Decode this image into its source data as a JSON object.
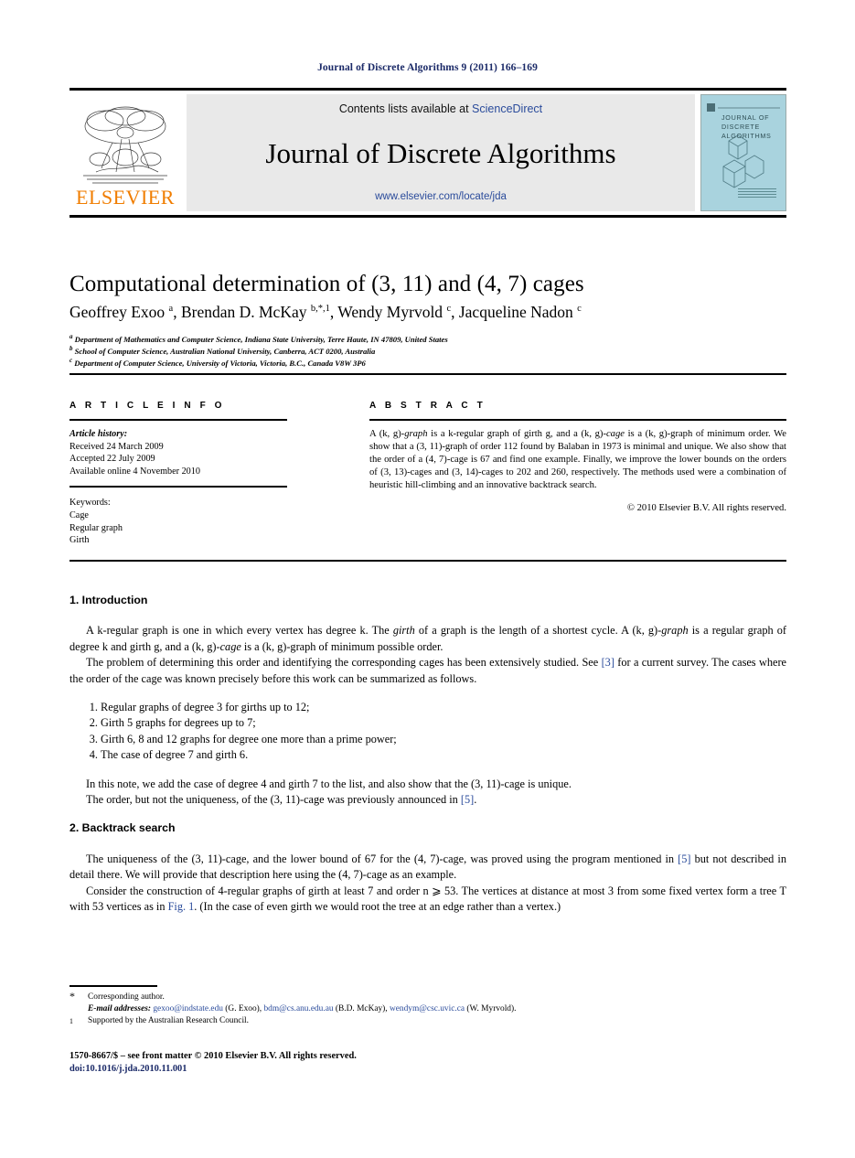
{
  "running_head": "Journal of Discrete Algorithms 9 (2011) 166–169",
  "masthead": {
    "publisher_name": "ELSEVIER",
    "contents_prefix": "Contents lists available at ",
    "contents_link": "ScienceDirect",
    "journal_name": "Journal of Discrete Algorithms",
    "journal_url": "www.elsevier.com/locate/jda",
    "cover_title_line1": "JOURNAL OF",
    "cover_title_line2": "DISCRETE",
    "cover_title_line3": "ALGORITHMS",
    "link_color": "#2a4b9b",
    "elsevier_orange": "#f07d00",
    "cover_color": "#a9d3de"
  },
  "article": {
    "title": "Computational determination of (3, 11) and (4, 7) cages",
    "authors_html": "Geoffrey Exoo <sup>a</sup>, Brendan D. McKay <sup>b,*,1</sup>, Wendy Myrvold <sup>c</sup>, Jacqueline Nadon <sup>c</sup>",
    "affiliation_a": "Department of Mathematics and Computer Science, Indiana State University, Terre Haute, IN 47809, United States",
    "affiliation_b": "School of Computer Science, Australian National University, Canberra, ACT 0200, Australia",
    "affiliation_c": "Department of Computer Science, University of Victoria, Victoria, B.C., Canada V8W 3P6",
    "mark_a": "a",
    "mark_b": "b",
    "mark_c": "c"
  },
  "info": {
    "heading": "A R T I C L E    I N F O",
    "history_label": "Article history:",
    "received": "Received 24 March 2009",
    "accepted": "Accepted 22 July 2009",
    "available": "Available online 4 November 2010",
    "keywords_label": "Keywords:",
    "keywords": [
      "Cage",
      "Regular graph",
      "Girth"
    ]
  },
  "abstract": {
    "heading": "A B S T R A C T",
    "text_html": "A (k, g)-<em>graph</em> is a k-regular graph of girth g, and a (k, g)-<em>cage</em> is a (k, g)-graph of minimum order. We show that a (3, 11)-graph of order 112 found by Balaban in 1973 is minimal and unique. We also show that the order of a (4, 7)-cage is 67 and find one example. Finally, we improve the lower bounds on the orders of (3, 13)-cages and (3, 14)-cages to 202 and 260, respectively. The methods used were a combination of heuristic hill-climbing and an innovative backtrack search.",
    "copyright": "© 2010 Elsevier B.V. All rights reserved."
  },
  "sections": [
    {
      "number_title": "1. Introduction",
      "paragraphs_html": [
        "A k-regular graph is one in which every vertex has degree k. The <em>girth</em> of a graph is the length of a shortest cycle. A (k, g)-<em>graph</em> is a regular graph of degree k and girth g, and a (k, g)-<em>cage</em> is a (k, g)-graph of minimum possible order.",
        "The problem of determining this order and identifying the corresponding cages has been extensively studied. See <span class=\"ref\">[3]</span> for a current survey. The cases where the order of the cage was known precisely before this work can be summarized as follows."
      ],
      "list_items": [
        "Regular graphs of degree 3 for girths up to 12;",
        "Girth 5 graphs for degrees up to 7;",
        "Girth 6, 8 and 12 graphs for degree one more than a prime power;",
        "The case of degree 7 and girth 6."
      ],
      "after_list_html": [
        "In this note, we add the case of degree 4 and girth 7 to the list, and also show that the (3, 11)-cage is unique.",
        "The order, but not the uniqueness, of the (3, 11)-cage was previously announced in <span class=\"ref\">[5]</span>."
      ]
    },
    {
      "number_title": "2. Backtrack search",
      "paragraphs_html": [
        "The uniqueness of the (3, 11)-cage, and the lower bound of 67 for the (4, 7)-cage, was proved using the program mentioned in <span class=\"ref\">[5]</span> but not described in detail there. We will provide that description here using the (4, 7)-cage as an example.",
        "Consider the construction of 4-regular graphs of girth at least 7 and order n ⩾ 53. The vertices at distance at most 3 from some fixed vertex form a tree T with 53 vertices as in <span class=\"ref\">Fig. 1</span>. (In the case of even girth we would root the tree at an edge rather than a vertex.)"
      ]
    }
  ],
  "footnotes": {
    "star_mark": "*",
    "star_text": "Corresponding author.",
    "email_label": "E-mail addresses:",
    "emails": [
      {
        "address": "gexoo@indstate.edu",
        "owner": "(G. Exoo),"
      },
      {
        "address": "bdm@cs.anu.edu.au",
        "owner": "(B.D. McKay),"
      },
      {
        "address": "wendym@csc.uvic.ca",
        "owner": "(W. Myrvold)."
      }
    ],
    "one_mark": "1",
    "one_text": "Supported by the Australian Research Council."
  },
  "footer": {
    "front_matter": "1570-8667/$ – see front matter © 2010 Elsevier B.V. All rights reserved.",
    "doi": "doi:10.1016/j.jda.2010.11.001"
  }
}
